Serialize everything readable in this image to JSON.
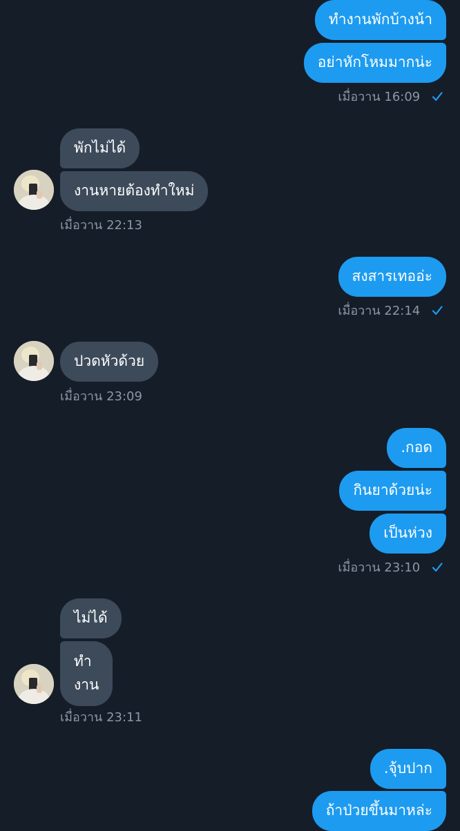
{
  "colors": {
    "background": "#151d28",
    "outgoing_bubble": "#1d9bf0",
    "incoming_bubble": "#3c4a5a",
    "timestamp": "#8b98a5",
    "read_check": "#1d9bf0"
  },
  "messages": [
    {
      "direction": "outgoing",
      "text": "ทำงานพักบ้างน้า"
    },
    {
      "direction": "outgoing",
      "text": "อย่าหักโหมมากน่ะ"
    },
    {
      "direction": "outgoing",
      "timestamp": "เมื่อวาน 16:09",
      "status": "sent-check-icon"
    },
    {
      "direction": "incoming",
      "text": "พักไม่ได้"
    },
    {
      "direction": "incoming",
      "text": "งานหายต้องทำใหม่"
    },
    {
      "direction": "incoming",
      "timestamp": "เมื่อวาน 22:13"
    },
    {
      "direction": "outgoing",
      "text": "สงสารเทออ่ะ"
    },
    {
      "direction": "outgoing",
      "timestamp": "เมื่อวาน 22:14",
      "status": "sent-check-icon"
    },
    {
      "direction": "incoming",
      "text": "ปวดหัวด้วย"
    },
    {
      "direction": "incoming",
      "timestamp": "เมื่อวาน 23:09"
    },
    {
      "direction": "outgoing",
      "text": ".กอด"
    },
    {
      "direction": "outgoing",
      "text": "กินยาด้วยน่ะ"
    },
    {
      "direction": "outgoing",
      "text": "เป็นห่วง"
    },
    {
      "direction": "outgoing",
      "timestamp": "เมื่อวาน 23:10",
      "status": "sent-check-icon"
    },
    {
      "direction": "incoming",
      "text": "ไม่ได้"
    },
    {
      "direction": "incoming",
      "text_lines": [
        "ทำ",
        "งาน"
      ]
    },
    {
      "direction": "incoming",
      "timestamp": "เมื่อวาน 23:11"
    },
    {
      "direction": "outgoing",
      "text": ".จุ้บปาก"
    },
    {
      "direction": "outgoing",
      "text": "ถ้าป่วยขึ้นมาหล่ะ"
    }
  ],
  "avatar": {
    "icon": "user-avatar"
  }
}
